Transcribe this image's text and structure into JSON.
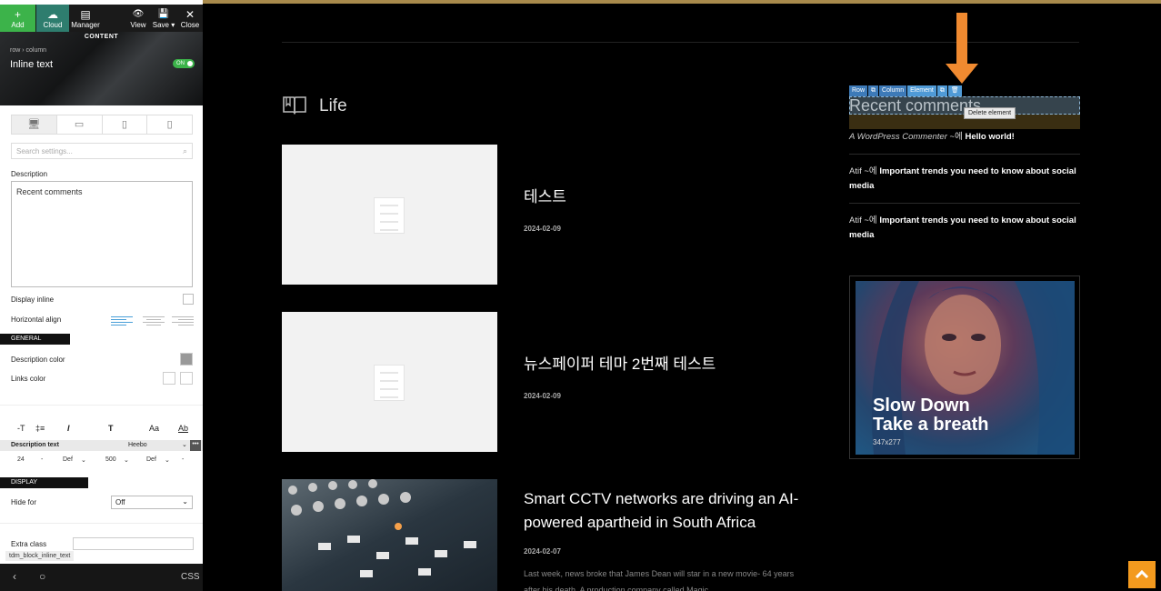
{
  "toolbar": {
    "add": "Add",
    "cloud": "Cloud",
    "manager": "Manager",
    "view": "View",
    "save": "Save ▾",
    "close": "Close",
    "add_glyph": "+",
    "cloud_glyph": "☁",
    "manager_glyph": "▤",
    "view_glyph": "👁",
    "save_glyph": "💾",
    "close_glyph": "✕"
  },
  "panel": {
    "content_label": "CONTENT",
    "breadcrumb": "row › column",
    "title": "Inline text",
    "toggle": "ON",
    "tabs": [
      "General",
      "Css"
    ],
    "search_placeholder": "Search settings...",
    "description_label": "Description",
    "description_value": "Recent comments",
    "display_inline": "Display inline",
    "horizontal_align": "Horizontal align",
    "general_style": "GENERAL STYLE",
    "description_color": "Description color",
    "links_color": "Links color",
    "typo_icons": [
      "-T",
      "‡≡",
      "I",
      "T",
      "Aa",
      "Ab"
    ],
    "desc_text": "Description text",
    "font_name": "Heebo",
    "font_values": [
      "24",
      "-",
      "Def",
      "⌄",
      "500",
      "⌄",
      "Def",
      "⌄",
      "-"
    ],
    "display_restrictions": "DISPLAY RESTRICTIONS",
    "hide_for": "Hide for",
    "hide_value": "Off",
    "extra_class": "Extra class",
    "class_name": "tdm_block_inline_text",
    "footer_back": "‹",
    "footer_home": "○",
    "footer_css": "CSS"
  },
  "main": {
    "section_title": "Life",
    "posts": [
      {
        "title": "테스트",
        "date": "2024-02-09"
      },
      {
        "title": "뉴스페이퍼 테마 2번째 테스트",
        "date": "2024-02-09"
      },
      {
        "title": "Smart CCTV networks are driving an AI-powered apartheid in South Africa",
        "date": "2024-02-07",
        "excerpt": "Last week, news broke that James Dean will star in a new movie- 64 years after his death. A production company called Magic"
      }
    ]
  },
  "sidebar": {
    "vc_buttons": [
      "Row",
      "⧉",
      "Column",
      "Element",
      "⧉",
      "🗑"
    ],
    "widget_title": "Recent comments",
    "tooltip": "Delete element",
    "comments": [
      {
        "author": "A WordPress Commenter",
        "sep": "~에",
        "post": "Hello world!"
      },
      {
        "author": "Atif",
        "sep": "~에",
        "post": "Important trends you need to know about social media"
      },
      {
        "author": "Atif",
        "sep": "~에",
        "post": "Important trends you need to know about social media"
      }
    ],
    "ad_line1": "Slow Down",
    "ad_line2": "Take a breath",
    "ad_size": "347x277"
  },
  "scroll_top": "^",
  "colors": {
    "accent_orange": "#f39a1e",
    "toggle_green": "#3cb34a",
    "vc_blue": "#3d7ab8"
  }
}
